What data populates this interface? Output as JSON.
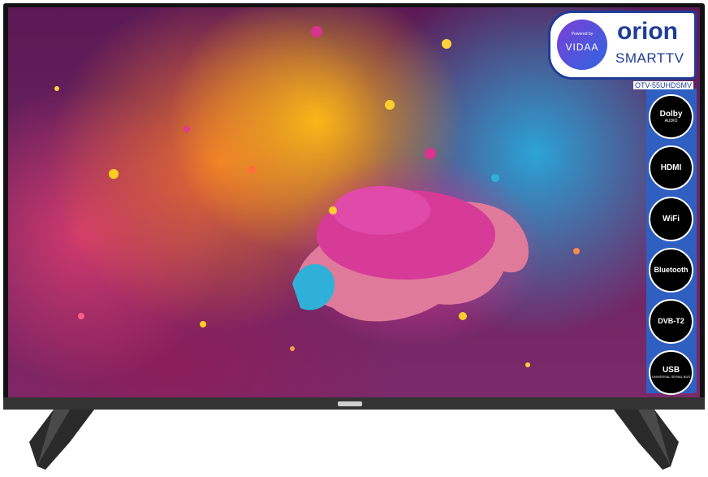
{
  "tv": {
    "brand": "orion",
    "product_line": "SMARTTV",
    "model": "OTV-55UHDSMV",
    "os_badge": {
      "powered_by": "Powered by",
      "name": "VIDAA"
    }
  },
  "features": [
    {
      "label": "Dolby",
      "sub": "AUDIO",
      "icon": "dolby-icon"
    },
    {
      "label": "HDMI",
      "sub": "",
      "icon": "hdmi-icon"
    },
    {
      "label": "WiFi",
      "sub": "",
      "icon": "wifi-icon"
    },
    {
      "label": "Bluetooth",
      "sub": "",
      "icon": "bluetooth-icon"
    },
    {
      "label": "DVB-T2",
      "sub": "",
      "icon": "dvb-icon"
    },
    {
      "label": "USB",
      "sub": "UNIVERSAL SERIAL BUS",
      "icon": "usb-icon"
    }
  ],
  "colors": {
    "brand_blue": "#1f3c97",
    "strip_blue": "#2f5fc0",
    "bezel": "#111111"
  }
}
